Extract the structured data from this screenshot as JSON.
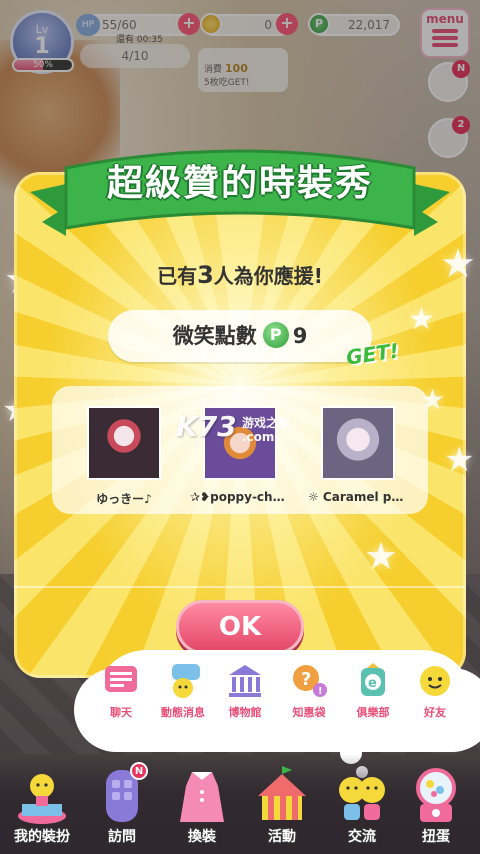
{
  "hud": {
    "level_label": "Lv",
    "level": "1",
    "exp_percent": "50%",
    "exp_fraction": 0.5,
    "hp_tag": "HP",
    "hp_value": "55/60",
    "hp_recover": "還有 00:35",
    "gold": "0",
    "premium": "22,017",
    "premium_symbol": "P",
    "menu_label": "menu",
    "quest": "4/10",
    "event_cost_label": "消費",
    "event_cost_value": "100",
    "event_reward": "5枚吃GET!",
    "side_badges": [
      "N",
      "2"
    ]
  },
  "modal": {
    "title": "超級贊的時裝秀",
    "cheer_prefix": "已有",
    "cheer_count": "3",
    "cheer_suffix": "人為你應援!",
    "score_label": "微笑點數",
    "score_symbol": "P",
    "score_value": "9",
    "get_label": "GET!",
    "friends": [
      {
        "name": "ゆっきー♪"
      },
      {
        "name": "✰❥poppy-chan..."
      },
      {
        "name": "☼ Caramel pop..."
      }
    ],
    "ok_label": "OK"
  },
  "watermark": {
    "logo": "K73",
    "cn": "游戏之家",
    "domain": ".com"
  },
  "cloud_menu": [
    {
      "label": "聊天",
      "icon": "chat-icon",
      "color": "#f06b9a"
    },
    {
      "label": "動態消息",
      "icon": "news-icon",
      "color": "#7ac0e8"
    },
    {
      "label": "博物館",
      "icon": "museum-icon",
      "color": "#8a7ad8"
    },
    {
      "label": "知惠袋",
      "icon": "help-icon",
      "color": "#f0a040"
    },
    {
      "label": "俱樂部",
      "icon": "club-icon",
      "color": "#5ac0b0"
    },
    {
      "label": "好友",
      "icon": "friend-smile-icon",
      "color": "#f5d83a"
    }
  ],
  "bottom_nav": [
    {
      "label": "我的裝扮",
      "icon": "wardrobe-stage-icon"
    },
    {
      "label": "訪問",
      "icon": "door-icon",
      "badge": "N"
    },
    {
      "label": "換裝",
      "icon": "dress-icon"
    },
    {
      "label": "活動",
      "icon": "circus-tent-icon"
    },
    {
      "label": "交流",
      "icon": "friends-pair-icon"
    },
    {
      "label": "扭蛋",
      "icon": "gacha-machine-icon"
    }
  ]
}
